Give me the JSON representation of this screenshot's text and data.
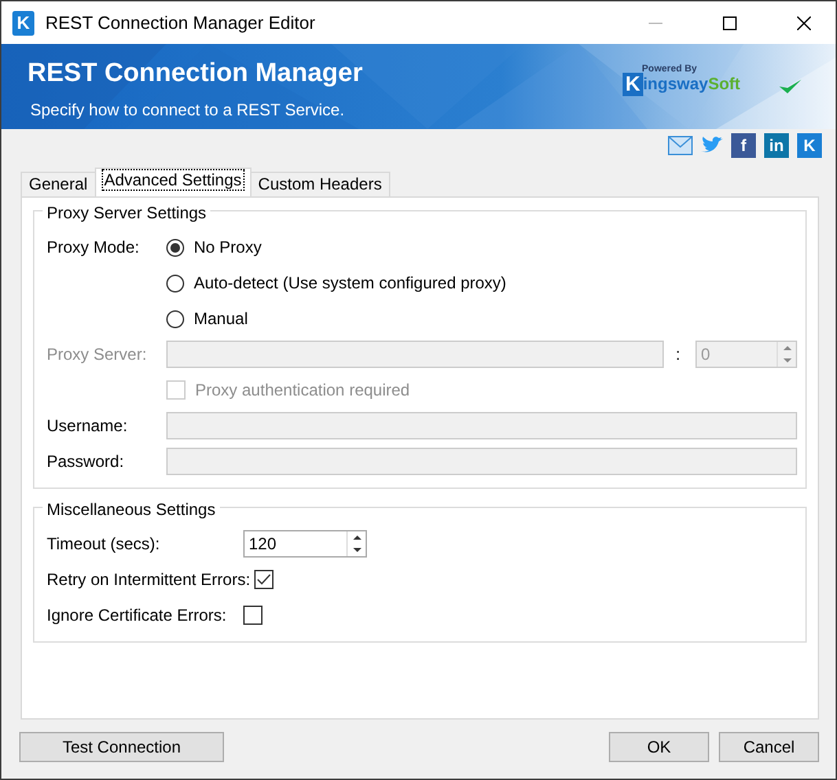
{
  "window": {
    "title": "REST Connection Manager Editor",
    "icon_letter": "K"
  },
  "banner": {
    "title": "REST Connection Manager",
    "subtitle": "Specify how to connect to a REST Service.",
    "powered_by": "Powered By",
    "brand": [
      {
        "text": "K",
        "kind": "box"
      },
      {
        "text": "ingsway",
        "kind": "blue"
      },
      {
        "text": "Soft",
        "kind": "green"
      }
    ]
  },
  "social": [
    {
      "kind": "mail"
    },
    {
      "kind": "twitter"
    },
    {
      "kind": "facebook",
      "glyph": "f"
    },
    {
      "kind": "linkedin",
      "glyph": "in"
    },
    {
      "kind": "kingsway",
      "glyph": "K"
    }
  ],
  "tabs": [
    {
      "label": "General",
      "selected": false
    },
    {
      "label": "Advanced Settings",
      "selected": true
    },
    {
      "label": "Custom Headers",
      "selected": false
    }
  ],
  "proxy": {
    "title": "Proxy Server Settings",
    "mode_label": "Proxy Mode:",
    "modes": [
      {
        "label": "No Proxy",
        "selected": true
      },
      {
        "label": "Auto-detect (Use system configured proxy)",
        "selected": false
      },
      {
        "label": "Manual",
        "selected": false
      }
    ],
    "server_label": "Proxy Server:",
    "port_separator": ":",
    "port": "0",
    "disabled": true,
    "auth": {
      "label": "Proxy authentication required",
      "checked": false
    },
    "username_label": "Username:",
    "password_label": "Password:"
  },
  "misc": {
    "title": "Miscellaneous Settings",
    "timeout_label": "Timeout (secs):",
    "timeout": "120",
    "options": [
      {
        "label": "Retry on Intermittent Errors:",
        "checked": true
      },
      {
        "label": "Ignore Certificate Errors:",
        "checked": false
      }
    ]
  },
  "buttons": {
    "test": "Test Connection",
    "ok": "OK",
    "cancel": "Cancel"
  }
}
